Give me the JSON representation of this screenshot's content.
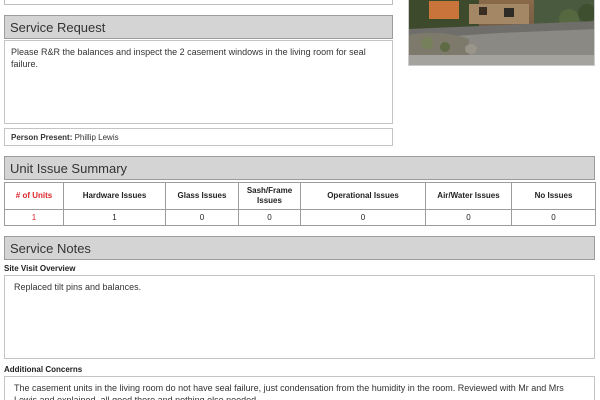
{
  "colors": {
    "header_bg": "#d4d4d4",
    "accent_red": "#d9262a"
  },
  "service_request": {
    "title": "Service Request",
    "text": "Please R&R the balances and inspect the 2 casement windows in the living room for seal failure.",
    "person_present_label": "Person Present:",
    "person_present_value": "Phillip Lewis"
  },
  "unit_issue_summary": {
    "title": "Unit Issue Summary",
    "columns": [
      "# of Units",
      "Hardware Issues",
      "Glass Issues",
      "Sash/Frame Issues",
      "Operational Issues",
      "Air/Water Issues",
      "No Issues"
    ],
    "values": [
      "1",
      "1",
      "0",
      "0",
      "0",
      "0",
      "0"
    ]
  },
  "service_notes": {
    "title": "Service Notes",
    "site_visit_label": "Site Visit Overview",
    "site_visit_text": "Replaced tilt pins and balances.",
    "additional_concerns_label": "Additional Concerns",
    "additional_concerns_text": "The casement units in the living room do not have seal failure, just condensation from the humidity in the room.  Reviewed with Mr and Mrs Lewis and explained, all good there and nothing else needed."
  }
}
